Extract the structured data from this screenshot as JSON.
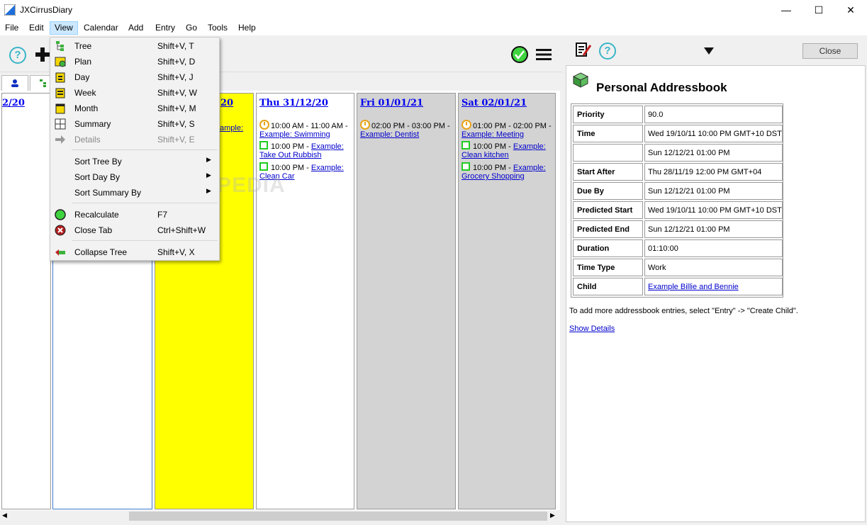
{
  "window": {
    "title": "JXCirrusDiary",
    "minimize": "—",
    "maximize": "☐",
    "close": "✕"
  },
  "menubar": [
    "File",
    "Edit",
    "View",
    "Calendar",
    "Add",
    "Entry",
    "Go",
    "Tools",
    "Help"
  ],
  "view_menu": {
    "items": [
      {
        "label": "Tree",
        "shortcut": "Shift+V, T",
        "icon": "tree-icon"
      },
      {
        "label": "Plan",
        "shortcut": "Shift+V, D",
        "icon": "plan-icon"
      },
      {
        "label": "Day",
        "shortcut": "Shift+V, J",
        "icon": "day-icon"
      },
      {
        "label": "Week",
        "shortcut": "Shift+V, W",
        "icon": "week-icon"
      },
      {
        "label": "Month",
        "shortcut": "Shift+V, M",
        "icon": "month-icon"
      },
      {
        "label": "Summary",
        "shortcut": "Shift+V, S",
        "icon": "summary-icon"
      },
      {
        "label": "Details",
        "shortcut": "Shift+V, E",
        "icon": "arrow-right-icon",
        "disabled": true
      },
      {
        "label": "Sort Tree By",
        "submenu": true
      },
      {
        "label": "Sort Day By",
        "submenu": true
      },
      {
        "label": "Sort Summary By",
        "submenu": true
      },
      {
        "label": "Recalculate",
        "shortcut": "F7",
        "icon": "recalculate-icon"
      },
      {
        "label": "Close Tab",
        "shortcut": "Ctrl+Shift+W",
        "icon": "close-tab-icon"
      },
      {
        "label": "Collapse Tree",
        "shortcut": "Shift+V, X",
        "icon": "collapse-tree-icon"
      }
    ]
  },
  "calendar": {
    "partial_first_header": "2/20",
    "partial_yellow_header": "20",
    "partial_yellow_entry": "ample:",
    "days": [
      {
        "header": "Thu 31/12/20",
        "entries": [
          {
            "kind": "event",
            "time": "10:00 AM - 11:00 AM -",
            "link": "Example: Swimming"
          },
          {
            "kind": "todo",
            "time": "10:00 PM -",
            "link1": "Example:",
            "link2": "Take Out Rubbish"
          },
          {
            "kind": "todo",
            "time": "10:00 PM -",
            "link1": "Example:",
            "link2": "Clean Car"
          }
        ]
      },
      {
        "header": "Fri 01/01/21",
        "entries": [
          {
            "kind": "event",
            "time": "02:00 PM - 03:00 PM -",
            "link": "Example: Dentist"
          }
        ]
      },
      {
        "header": "Sat 02/01/21",
        "entries": [
          {
            "kind": "event",
            "time": "01:00 PM - 02:00 PM -",
            "link": "Example: Meeting"
          },
          {
            "kind": "todo",
            "time": "10:00 PM -",
            "link1": "Example:",
            "link2": "Clean kitchen"
          },
          {
            "kind": "todo",
            "time": "10:00 PM -",
            "link1": "Example:",
            "link2": "Grocery Shopping"
          }
        ]
      }
    ]
  },
  "details": {
    "close_label": "Close",
    "title": "Personal Addressbook",
    "properties": [
      {
        "key": "Priority",
        "value": "90.0"
      },
      {
        "key": "Time",
        "value": "Wed 19/10/11 10:00 PM GMT+10 DST"
      },
      {
        "key": "",
        "value": "Sun 12/12/21 01:00 PM"
      },
      {
        "key": "Start After",
        "value": "Thu 28/11/19 12:00 PM GMT+04"
      },
      {
        "key": "Due By",
        "value": "Sun 12/12/21 01:00 PM"
      },
      {
        "key": "Predicted Start",
        "value": "Wed 19/10/11 10:00 PM GMT+10 DST"
      },
      {
        "key": "Predicted End",
        "value": "Sun 12/12/21 01:00 PM"
      },
      {
        "key": "Duration",
        "value": "01:10:00"
      },
      {
        "key": "Time Type",
        "value": "Work"
      },
      {
        "key": "Child",
        "value": "Example Billie and Bennie",
        "link": true
      }
    ],
    "hint": "To add more addressbook entries, select \"Entry\" -> \"Create Child\".",
    "show_details": "Show Details"
  },
  "watermark": "SOFTPEDIA",
  "colors": {
    "today": "#ffff00",
    "weekend": "#d3d3d3",
    "link": "#0000cc",
    "menu_highlight": "#cce8ff"
  }
}
